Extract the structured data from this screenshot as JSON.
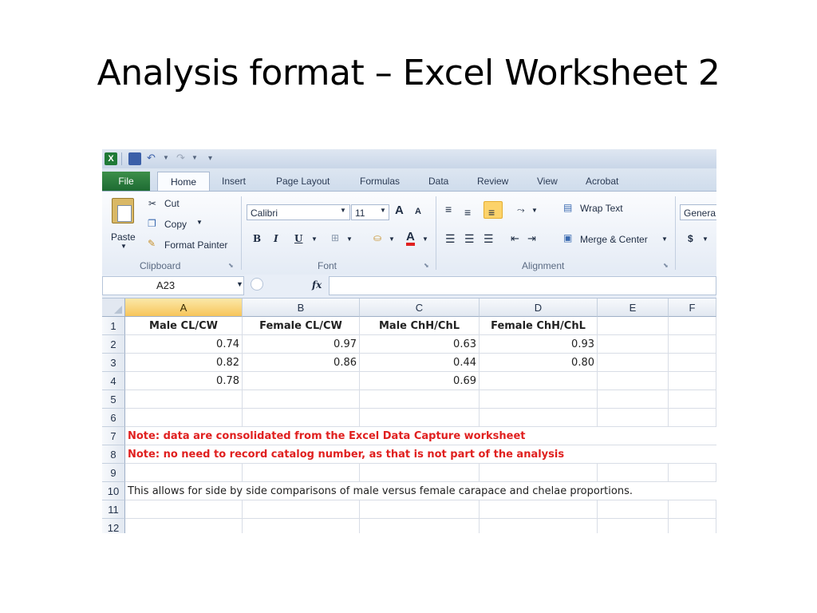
{
  "slide_title": "Analysis format – Excel Worksheet 2",
  "qat": {
    "app_icon_letter": "X"
  },
  "tabs": [
    "File",
    "Home",
    "Insert",
    "Page Layout",
    "Formulas",
    "Data",
    "Review",
    "View",
    "Acrobat"
  ],
  "ribbon": {
    "clipboard": {
      "paste": "Paste",
      "cut": "Cut",
      "copy": "Copy",
      "format_painter": "Format Painter",
      "label": "Clipboard"
    },
    "font": {
      "name": "Calibri",
      "size": "11",
      "bold": "B",
      "italic": "I",
      "underline": "U",
      "grow": "A",
      "shrink": "A",
      "font_color": "A",
      "label": "Font"
    },
    "alignment": {
      "wrap_text": "Wrap Text",
      "merge_center": "Merge & Center",
      "label": "Alignment"
    },
    "number": {
      "format": "Genera",
      "currency": "$"
    }
  },
  "formula_bar": {
    "name_box": "A23",
    "fx": "fx",
    "formula": ""
  },
  "sheet": {
    "columns": [
      "A",
      "B",
      "C",
      "D",
      "E",
      "F"
    ],
    "selected_column": "A",
    "rows": [
      {
        "num": "1",
        "cells": [
          "Male CL/CW",
          "Female CL/CW",
          "Male ChH/ChL",
          "Female ChH/ChL",
          "",
          ""
        ]
      },
      {
        "num": "2",
        "cells": [
          "0.74",
          "0.97",
          "0.63",
          "0.93",
          "",
          ""
        ]
      },
      {
        "num": "3",
        "cells": [
          "0.82",
          "0.86",
          "0.44",
          "0.80",
          "",
          ""
        ]
      },
      {
        "num": "4",
        "cells": [
          "0.78",
          "",
          "0.69",
          "",
          "",
          ""
        ]
      },
      {
        "num": "5",
        "cells": [
          "",
          "",
          "",
          "",
          "",
          ""
        ]
      },
      {
        "num": "6",
        "cells": [
          "",
          "",
          "",
          "",
          "",
          ""
        ]
      },
      {
        "num": "7",
        "text": "Note: data are consolidated from the Excel Data Capture worksheet"
      },
      {
        "num": "8",
        "text": "Note: no need to record catalog number, as that is not part of the analysis"
      },
      {
        "num": "9",
        "cells": [
          "",
          "",
          "",
          "",
          "",
          ""
        ]
      },
      {
        "num": "10",
        "text": "This allows for side by side comparisons of male versus female carapace and chelae proportions."
      },
      {
        "num": "11",
        "cells": [
          "",
          "",
          "",
          "",
          "",
          ""
        ]
      },
      {
        "num": "12",
        "cells": [
          "",
          "",
          "",
          "",
          "",
          ""
        ]
      }
    ]
  },
  "colors": {
    "note_red": "#e0201f",
    "file_tab_green": "#1e6b33",
    "selected_header": "#f7c55a"
  }
}
